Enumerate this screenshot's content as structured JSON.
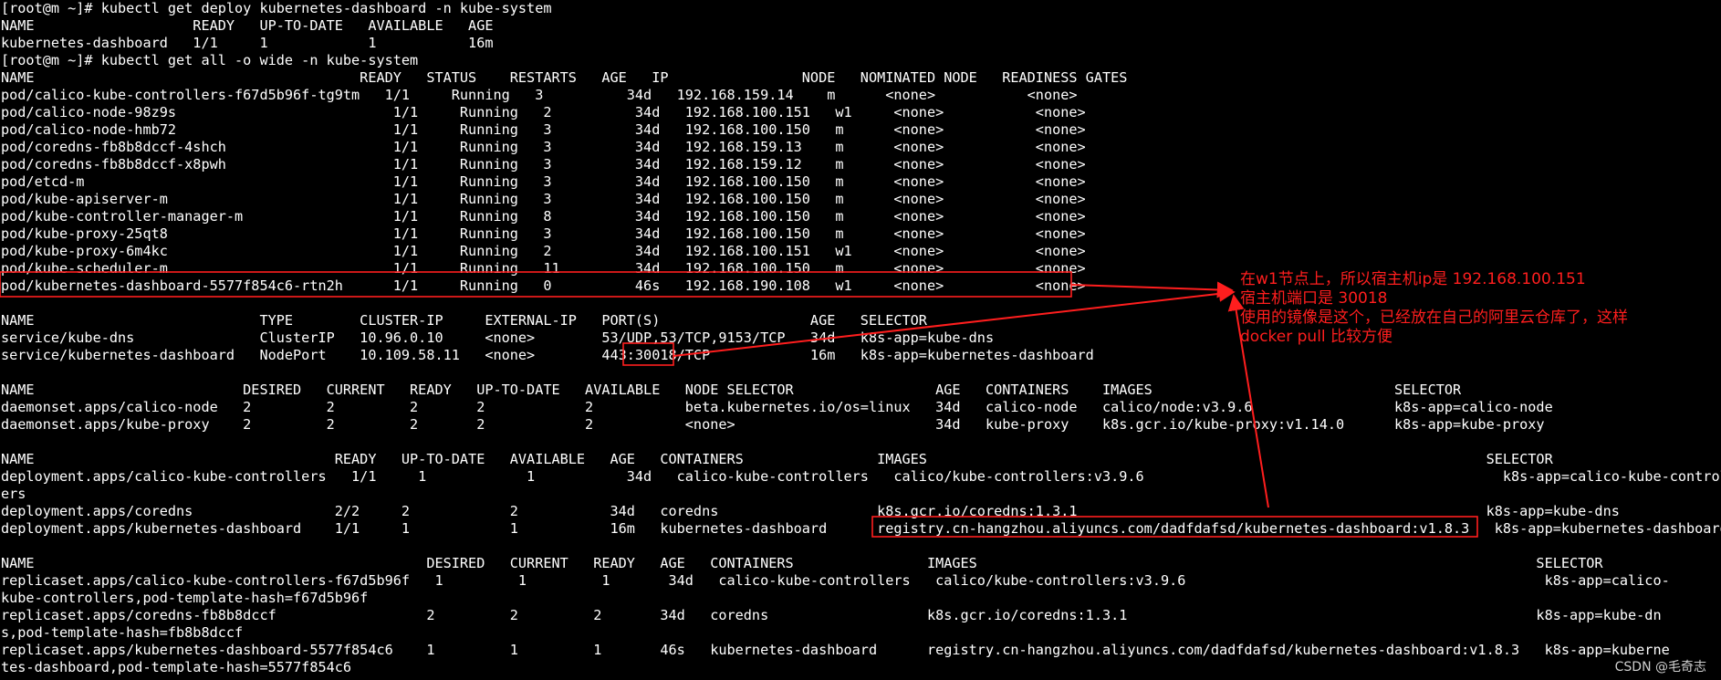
{
  "terminal": {
    "lines": [
      "[root@m ~]# kubectl get deploy kubernetes-dashboard -n kube-system",
      "NAME                   READY   UP-TO-DATE   AVAILABLE   AGE",
      "kubernetes-dashboard   1/1     1            1           16m",
      "[root@m ~]# kubectl get all -o wide -n kube-system",
      "NAME                                       READY   STATUS    RESTARTS   AGE   IP                NODE   NOMINATED NODE   READINESS GATES",
      "pod/calico-kube-controllers-f67d5b96f-tg9tm   1/1     Running   3          34d   192.168.159.14    m      <none>           <none>",
      "pod/calico-node-98z9s                          1/1     Running   2          34d   192.168.100.151   w1     <none>           <none>",
      "pod/calico-node-hmb72                          1/1     Running   3          34d   192.168.100.150   m      <none>           <none>",
      "pod/coredns-fb8b8dccf-4shch                    1/1     Running   3          34d   192.168.159.13    m      <none>           <none>",
      "pod/coredns-fb8b8dccf-x8pwh                    1/1     Running   3          34d   192.168.159.12    m      <none>           <none>",
      "pod/etcd-m                                     1/1     Running   3          34d   192.168.100.150   m      <none>           <none>",
      "pod/kube-apiserver-m                           1/1     Running   3          34d   192.168.100.150   m      <none>           <none>",
      "pod/kube-controller-manager-m                  1/1     Running   8          34d   192.168.100.150   m      <none>           <none>",
      "pod/kube-proxy-25qt8                           1/1     Running   3          34d   192.168.100.150   m      <none>           <none>",
      "pod/kube-proxy-6m4kc                           1/1     Running   2          34d   192.168.100.151   w1     <none>           <none>",
      "pod/kube-scheduler-m                           1/1     Running   11         34d   192.168.100.150   m      <none>           <none>",
      "pod/kubernetes-dashboard-5577f854c6-rtn2h      1/1     Running   0          46s   192.168.190.108   w1     <none>           <none>",
      "",
      "NAME                           TYPE        CLUSTER-IP     EXTERNAL-IP   PORT(S)                  AGE   SELECTOR",
      "service/kube-dns               ClusterIP   10.96.0.10     <none>        53/UDP,53/TCP,9153/TCP   34d   k8s-app=kube-dns",
      "service/kubernetes-dashboard   NodePort    10.109.58.11   <none>        443:30018/TCP            16m   k8s-app=kubernetes-dashboard",
      "",
      "NAME                         DESIRED   CURRENT   READY   UP-TO-DATE   AVAILABLE   NODE SELECTOR                 AGE   CONTAINERS    IMAGES                             SELECTOR",
      "daemonset.apps/calico-node   2         2         2       2            2           beta.kubernetes.io/os=linux   34d   calico-node   calico/node:v3.9.6                 k8s-app=calico-node",
      "daemonset.apps/kube-proxy    2         2         2       2            2           <none>                        34d   kube-proxy    k8s.gcr.io/kube-proxy:v1.14.0      k8s-app=kube-proxy",
      "",
      "NAME                                    READY   UP-TO-DATE   AVAILABLE   AGE   CONTAINERS                IMAGES                                                                   SELECTOR",
      "deployment.apps/calico-kube-controllers   1/1     1            1           34d   calico-kube-controllers   calico/kube-controllers:v3.9.6                                           k8s-app=calico-kube-controll",
      "ers",
      "deployment.apps/coredns                 2/2     2            2           34d   coredns                   k8s.gcr.io/coredns:1.3.1                                                 k8s-app=kube-dns",
      "deployment.apps/kubernetes-dashboard    1/1     1            1           16m   kubernetes-dashboard      registry.cn-hangzhou.aliyuncs.com/dadfdafsd/kubernetes-dashboard:v1.8.3   k8s-app=kubernetes-dashboard",
      "",
      "NAME                                               DESIRED   CURRENT   READY   AGE   CONTAINERS                IMAGES                                                                   SELECTOR",
      "replicaset.apps/calico-kube-controllers-f67d5b96f   1         1         1       34d   calico-kube-controllers   calico/kube-controllers:v3.9.6                                           k8s-app=calico-",
      "kube-controllers,pod-template-hash=f67d5b96f",
      "replicaset.apps/coredns-fb8b8dccf                  2         2         2       34d   coredns                   k8s.gcr.io/coredns:1.3.1                                                 k8s-app=kube-dn",
      "s,pod-template-hash=fb8b8dccf",
      "replicaset.apps/kubernetes-dashboard-5577f854c6    1         1         1       46s   kubernetes-dashboard      registry.cn-hangzhou.aliyuncs.com/dadfdafsd/kubernetes-dashboard:v1.8.3   k8s-app=kuberne",
      "tes-dashboard,pod-template-hash=5577f854c6"
    ]
  },
  "annotation": {
    "text": "在w1节点上，所以宿主机ip是 192.168.100.151\n宿主机端口是 30018\n使用的镜像是这个，已经放在自己的阿里云仓库了，这样\ndocker pull 比较方便",
    "color": "#ff1e1e"
  },
  "watermark": "CSDN @毛奇志",
  "colors": {
    "background": "#000000",
    "text": "#ffffff",
    "highlight": "#ff1e1e"
  }
}
